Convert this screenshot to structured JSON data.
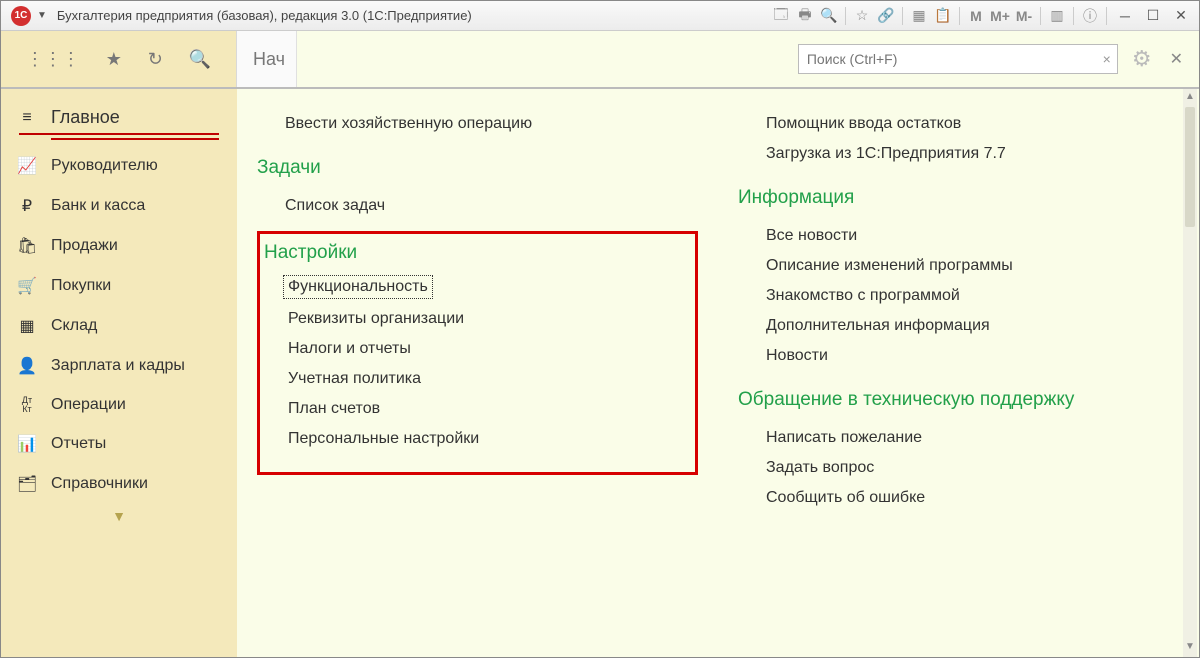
{
  "window": {
    "title": "Бухгалтерия предприятия (базовая), редакция 3.0  (1С:Предприятие)",
    "logo_text": "1С"
  },
  "toolbar": {
    "tab_stub": "Нач"
  },
  "search": {
    "placeholder": "Поиск (Ctrl+F)"
  },
  "sidebar": {
    "items": [
      {
        "label": "Главное",
        "icon": "≡",
        "active": true
      },
      {
        "label": "Руководителю",
        "icon": "📈"
      },
      {
        "label": "Банк и касса",
        "icon": "₽"
      },
      {
        "label": "Продажи",
        "icon": "🛍"
      },
      {
        "label": "Покупки",
        "icon": "🛒"
      },
      {
        "label": "Склад",
        "icon": "▦"
      },
      {
        "label": "Зарплата и кадры",
        "icon": "👤"
      },
      {
        "label": "Операции",
        "icon": "Дт Кт"
      },
      {
        "label": "Отчеты",
        "icon": "📊"
      },
      {
        "label": "Справочники",
        "icon": "🗂"
      }
    ]
  },
  "content": {
    "left": {
      "top_cutoff_item": "Ввести хозяйственную операцию",
      "sections": [
        {
          "title": "Задачи",
          "items": [
            "Список задач"
          ]
        },
        {
          "title": "Настройки",
          "items": [
            "Функциональность",
            "Реквизиты организации",
            "Налоги и отчеты",
            "Учетная политика",
            "План счетов",
            "Персональные настройки"
          ],
          "highlighted": true,
          "focused_index": 0
        }
      ]
    },
    "right": {
      "top_cutoff_items": [
        "Помощник ввода остатков",
        "Загрузка из 1С:Предприятия 7.7"
      ],
      "sections": [
        {
          "title": "Информация",
          "items": [
            "Все новости",
            "Описание изменений программы",
            "Знакомство с программой",
            "Дополнительная информация",
            "Новости"
          ]
        },
        {
          "title": "Обращение в техническую поддержку",
          "items": [
            "Написать пожелание",
            "Задать вопрос",
            "Сообщить об ошибке"
          ]
        }
      ]
    }
  }
}
